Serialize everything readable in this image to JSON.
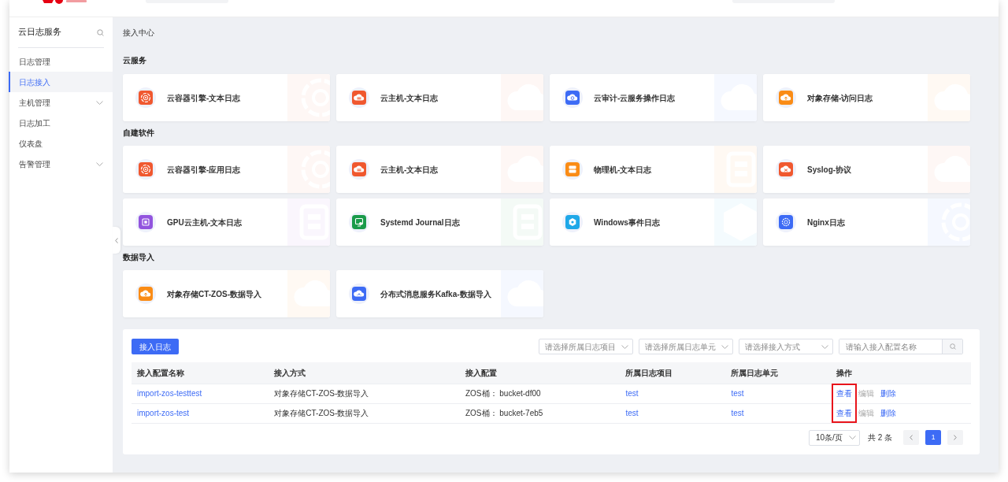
{
  "sidebar": {
    "title": "云日志服务",
    "items": [
      {
        "label": "日志管理",
        "selected": false,
        "expandable": false
      },
      {
        "label": "日志接入",
        "selected": true,
        "expandable": false
      },
      {
        "label": "主机管理",
        "selected": false,
        "expandable": true
      },
      {
        "label": "日志加工",
        "selected": false,
        "expandable": false
      },
      {
        "label": "仪表盘",
        "selected": false,
        "expandable": false
      },
      {
        "label": "告警管理",
        "selected": false,
        "expandable": true
      }
    ]
  },
  "page_title": "接入中心",
  "sections": [
    {
      "title": "云服务",
      "cards": [
        {
          "label": "云容器引擎-文本日志",
          "kind": "container",
          "color": "#f0582f"
        },
        {
          "label": "云主机-文本日志",
          "kind": "vm",
          "color": "#f0582f"
        },
        {
          "label": "云审计-云服务操作日志",
          "kind": "audit",
          "color": "#3d6bf5"
        },
        {
          "label": "对象存储-访问日志",
          "kind": "storage",
          "color": "#fa8c16"
        }
      ]
    },
    {
      "title": "自建软件",
      "cards": [
        {
          "label": "云容器引擎-应用日志",
          "kind": "container",
          "color": "#f0582f"
        },
        {
          "label": "云主机-文本日志",
          "kind": "vm",
          "color": "#f0582f"
        },
        {
          "label": "物理机-文本日志",
          "kind": "server",
          "color": "#fa8c16"
        },
        {
          "label": "Syslog-协议",
          "kind": "syslog",
          "color": "#f0582f"
        },
        {
          "label": "GPU云主机-文本日志",
          "kind": "gpu",
          "color": "#9254de"
        },
        {
          "label": "Systemd Journal日志",
          "kind": "systemd",
          "color": "#1a9b4b"
        },
        {
          "label": "Windows事件日志",
          "kind": "windows",
          "color": "#1fa8e8"
        },
        {
          "label": "Nginx日志",
          "kind": "nginx",
          "color": "#3d6bf5"
        }
      ]
    },
    {
      "title": "数据导入",
      "cards": [
        {
          "label": "对象存储CT-ZOS-数据导入",
          "kind": "storage",
          "color": "#fa8c16"
        },
        {
          "label": "分布式消息服务Kafka-数据导入",
          "kind": "kafka",
          "color": "#3d6bf5"
        }
      ]
    }
  ],
  "toolbar": {
    "button": "接入日志",
    "filters": [
      {
        "placeholder": "请选择所属日志项目"
      },
      {
        "placeholder": "请选择所属日志单元"
      },
      {
        "placeholder": "请选择接入方式"
      }
    ],
    "search": {
      "placeholder": "请输入接入配置名称"
    }
  },
  "table": {
    "columns": [
      "接入配置名称",
      "接入方式",
      "接入配置",
      "所属日志项目",
      "所属日志单元",
      "操作"
    ],
    "rows": [
      {
        "name": "import-zos-testtest",
        "method": "对象存储CT-ZOS-数据导入",
        "config": "ZOS桶：  bucket-df00",
        "project": "test",
        "unit": "test",
        "actions": [
          {
            "label": "查看",
            "disabled": false,
            "highlighted": true
          },
          {
            "label": "编辑",
            "disabled": true,
            "highlighted": false
          },
          {
            "label": "删除",
            "disabled": false,
            "highlighted": false
          }
        ]
      },
      {
        "name": "import-zos-test",
        "method": "对象存储CT-ZOS-数据导入",
        "config": "ZOS桶：  bucket-7eb5",
        "project": "test",
        "unit": "test",
        "actions": [
          {
            "label": "查看",
            "disabled": false,
            "highlighted": true
          },
          {
            "label": "编辑",
            "disabled": true,
            "highlighted": false
          },
          {
            "label": "删除",
            "disabled": false,
            "highlighted": false
          }
        ]
      }
    ]
  },
  "pagination": {
    "page_size": "10条/页",
    "total": "共 2 条",
    "pages": [
      {
        "label": "1",
        "selected": true
      }
    ]
  }
}
